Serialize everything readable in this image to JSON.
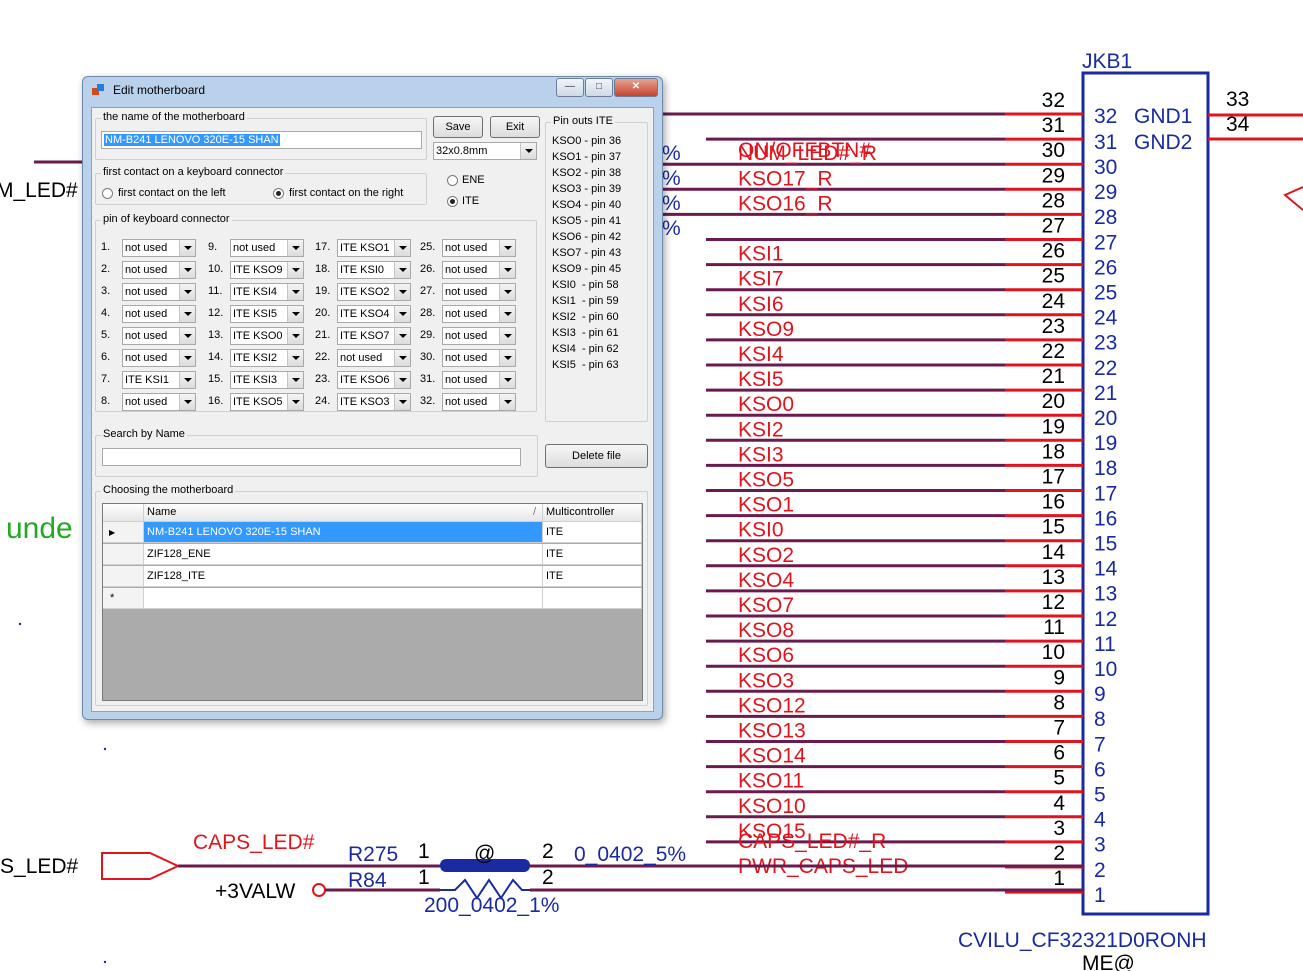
{
  "schematic": {
    "connector_ref": "JKB1",
    "part_number": "CVILU_CF32321D0RONH",
    "part_suffix": "ME@",
    "left_nets": [
      {
        "label": "M_LED#"
      },
      {
        "label": "PS_LED#"
      }
    ],
    "stray_text": "unde",
    "percent_marks": [
      "%",
      "%",
      "%",
      "%"
    ],
    "gnd_pins": [
      {
        "num": "32",
        "name": "GND1",
        "ext": "33"
      },
      {
        "num": "31",
        "name": "GND2",
        "ext": "34"
      }
    ],
    "rows": [
      {
        "pin": "32",
        "net": ""
      },
      {
        "pin": "31",
        "net": "ON/OFFBTN#"
      },
      {
        "pin": "30",
        "net": "NUM_LED#_R"
      },
      {
        "pin": "29",
        "net": "KSO17_R"
      },
      {
        "pin": "28",
        "net": "KSO16_R"
      },
      {
        "pin": "27",
        "net": ""
      },
      {
        "pin": "26",
        "net": "KSI1"
      },
      {
        "pin": "25",
        "net": "KSI7"
      },
      {
        "pin": "24",
        "net": "KSI6"
      },
      {
        "pin": "23",
        "net": "KSO9"
      },
      {
        "pin": "22",
        "net": "KSI4"
      },
      {
        "pin": "21",
        "net": "KSI5"
      },
      {
        "pin": "20",
        "net": "KSO0"
      },
      {
        "pin": "19",
        "net": "KSI2"
      },
      {
        "pin": "18",
        "net": "KSI3"
      },
      {
        "pin": "17",
        "net": "KSO5"
      },
      {
        "pin": "16",
        "net": "KSO1"
      },
      {
        "pin": "15",
        "net": "KSI0"
      },
      {
        "pin": "14",
        "net": "KSO2"
      },
      {
        "pin": "13",
        "net": "KSO4"
      },
      {
        "pin": "12",
        "net": "KSO7"
      },
      {
        "pin": "11",
        "net": "KSO8"
      },
      {
        "pin": "10",
        "net": "KSO6"
      },
      {
        "pin": "9",
        "net": "KSO3"
      },
      {
        "pin": "8",
        "net": "KSO12"
      },
      {
        "pin": "7",
        "net": "KSO13"
      },
      {
        "pin": "6",
        "net": "KSO14"
      },
      {
        "pin": "5",
        "net": "KSO11"
      },
      {
        "pin": "4",
        "net": "KSO10"
      },
      {
        "pin": "3",
        "net": "KSO15"
      },
      {
        "pin": "2",
        "net": ""
      },
      {
        "pin": "1",
        "net": ""
      }
    ],
    "overlap_labels": [
      "CAPS_LED#_R",
      "PWR_CAPS_LED"
    ],
    "jk_inner_pins": [
      "30",
      "29",
      "28",
      "27",
      "26",
      "25",
      "24",
      "23",
      "22",
      "21",
      "20",
      "19",
      "18",
      "17",
      "16",
      "15",
      "14",
      "13",
      "12",
      "11",
      "10",
      "9",
      "8",
      "7",
      "6",
      "5",
      "4",
      "3",
      "2",
      "1"
    ],
    "bottom": {
      "caps_net": "CAPS_LED#",
      "r275": "R275",
      "r84": "R84",
      "pin1a": "1",
      "pin2a": "2",
      "pin1b": "1",
      "pin2b": "2",
      "at": "@",
      "r275_val": "0_0402_5%",
      "r84_val": "200_0402_1%",
      "power": "+3VALW"
    }
  },
  "dialog": {
    "title": "Edit motherboard",
    "name_group": "the name of the motherboard",
    "name_value": "NM-B241 LENOVO 320E-15 SHAN",
    "save": "Save",
    "exit": "Exit",
    "size_value": "32x0.8mm",
    "first_contact_group": "first contact on a keyboard connector",
    "first_left": "first contact on the left",
    "first_right": "first contact on the right",
    "ene": "ENE",
    "ite": "ITE",
    "pins_group": "pin of keyboard connector",
    "pins": [
      {
        "n": "1.",
        "v": "not used"
      },
      {
        "n": "2.",
        "v": "not used"
      },
      {
        "n": "3.",
        "v": "not used"
      },
      {
        "n": "4.",
        "v": "not used"
      },
      {
        "n": "5.",
        "v": "not used"
      },
      {
        "n": "6.",
        "v": "not used"
      },
      {
        "n": "7.",
        "v": "ITE KSI1"
      },
      {
        "n": "8.",
        "v": "not used"
      },
      {
        "n": "9.",
        "v": "not used"
      },
      {
        "n": "10.",
        "v": "ITE KSO9"
      },
      {
        "n": "11.",
        "v": "ITE KSI4"
      },
      {
        "n": "12.",
        "v": "ITE KSI5"
      },
      {
        "n": "13.",
        "v": "ITE KSO0"
      },
      {
        "n": "14.",
        "v": "ITE KSI2"
      },
      {
        "n": "15.",
        "v": "ITE KSI3"
      },
      {
        "n": "16.",
        "v": "ITE KSO5"
      },
      {
        "n": "17.",
        "v": "ITE KSO1"
      },
      {
        "n": "18.",
        "v": "ITE KSI0"
      },
      {
        "n": "19.",
        "v": "ITE KSO2"
      },
      {
        "n": "20.",
        "v": "ITE KSO4"
      },
      {
        "n": "21.",
        "v": "ITE KSO7"
      },
      {
        "n": "22.",
        "v": "not used"
      },
      {
        "n": "23.",
        "v": "ITE KSO6"
      },
      {
        "n": "24.",
        "v": "ITE KSO3"
      },
      {
        "n": "25.",
        "v": "not used"
      },
      {
        "n": "26.",
        "v": "not used"
      },
      {
        "n": "27.",
        "v": "not used"
      },
      {
        "n": "28.",
        "v": "not used"
      },
      {
        "n": "29.",
        "v": "not used"
      },
      {
        "n": "30.",
        "v": "not used"
      },
      {
        "n": "31.",
        "v": "not used"
      },
      {
        "n": "32.",
        "v": "not used"
      }
    ],
    "pinouts_group": "Pin outs ITE",
    "pinouts": [
      "KSO0 - pin 36",
      "KSO1 - pin 37",
      "KSO2 - pin 38",
      "KSO3 - pin 39",
      "KSO4 - pin 40",
      "KSO5 - pin 41",
      "KSO6 - pin 42",
      "KSO7 - pin 43",
      "KSO9 - pin 45",
      "KSI0  - pin 58",
      "KSI1  - pin 59",
      "KSI2  - pin 60",
      "KSI3  - pin 61",
      "KSI4  - pin 62",
      "KSI5  - pin 63"
    ],
    "search_group": "Search by Name",
    "search_value": "",
    "delete_file": "Delete file",
    "choose_group": "Choosing the motherboard",
    "grid_headers": [
      "Name",
      "Multicontroller"
    ],
    "sort_glyph": "/",
    "grid_rows": [
      {
        "name": "NM-B241 LENOVO 320E-15 SHAN",
        "mc": "ITE"
      },
      {
        "name": "ZIF128_ENE",
        "mc": "ITE"
      },
      {
        "name": "ZIF128_ITE",
        "mc": "ITE"
      }
    ],
    "new_row_marker": "*"
  }
}
